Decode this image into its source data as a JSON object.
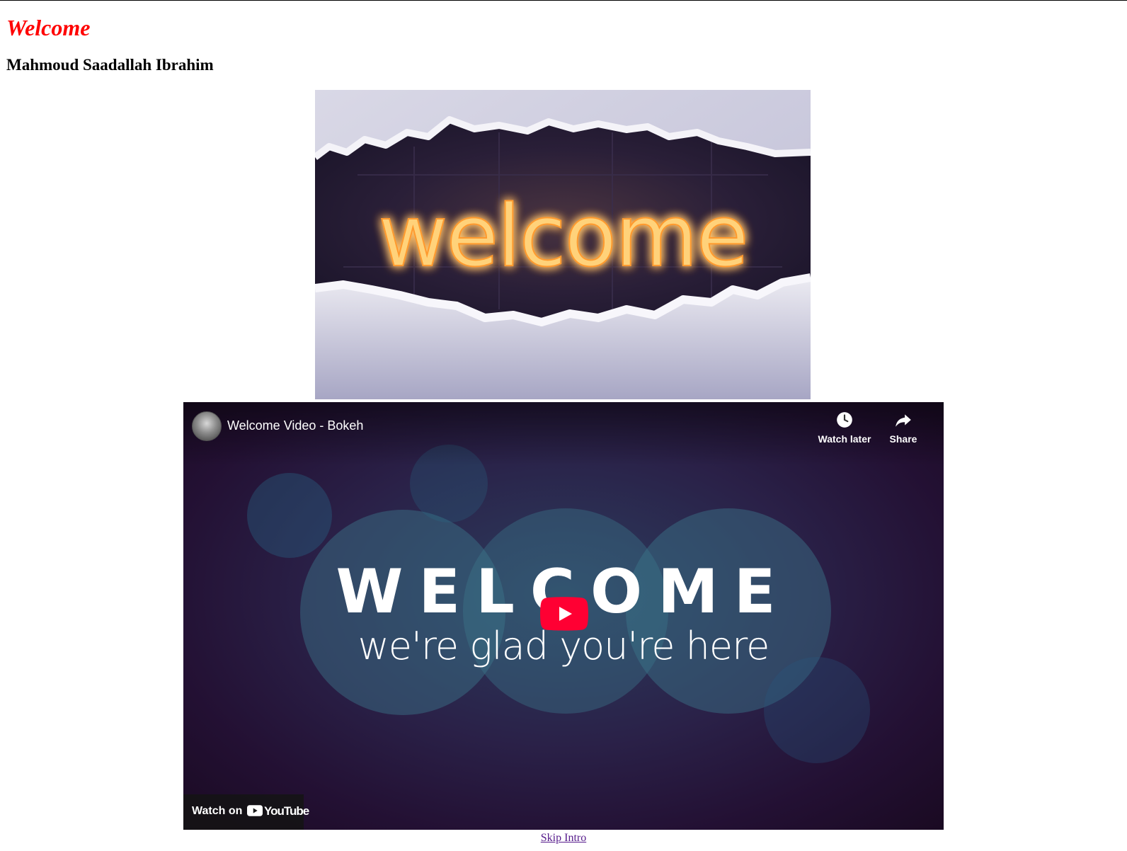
{
  "page": {
    "title": "Welcome",
    "author": "Mahmoud Saadallah Ibrahim"
  },
  "image": {
    "word": "welcome",
    "colors": {
      "neon": "#ffc04d",
      "glow": "#ff8a1a",
      "wall": "#d2d1e2",
      "dark": "#221a33"
    }
  },
  "video": {
    "title": "Welcome Video - Bokeh",
    "watch_later": "Watch later",
    "share": "Share",
    "heading": "WELCOME",
    "subheading": "we're glad you're here",
    "watch_on": "Watch on",
    "youtube": "YouTube",
    "colors": {
      "play": "#ff0033",
      "bg": "#2a2148"
    }
  },
  "link": {
    "skip": "Skip Intro"
  }
}
